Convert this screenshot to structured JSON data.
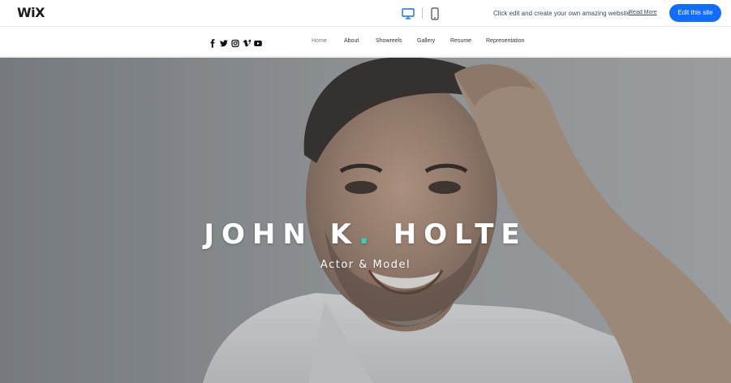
{
  "wix_bar": {
    "logo": "WiX",
    "promo_text": "Click edit and create your own amazing website",
    "read_more": "Read More",
    "edit_button": "Edit this site",
    "accent_color": "#116dff"
  },
  "site_header": {
    "social_icons": [
      "facebook-icon",
      "twitter-icon",
      "instagram-icon",
      "vimeo-icon",
      "youtube-icon"
    ],
    "nav": [
      {
        "label": "Home",
        "active": true
      },
      {
        "label": "About",
        "active": false
      },
      {
        "label": "Showreels",
        "active": false
      },
      {
        "label": "Gallery",
        "active": false
      },
      {
        "label": "Resume",
        "active": false
      },
      {
        "label": "Representation",
        "active": false
      }
    ]
  },
  "hero": {
    "name_part1": "JOHN K",
    "name_dot": ".",
    "name_part2": "HOLTE",
    "subtitle": "Actor & Model",
    "accent_color": "#2fd3be"
  }
}
